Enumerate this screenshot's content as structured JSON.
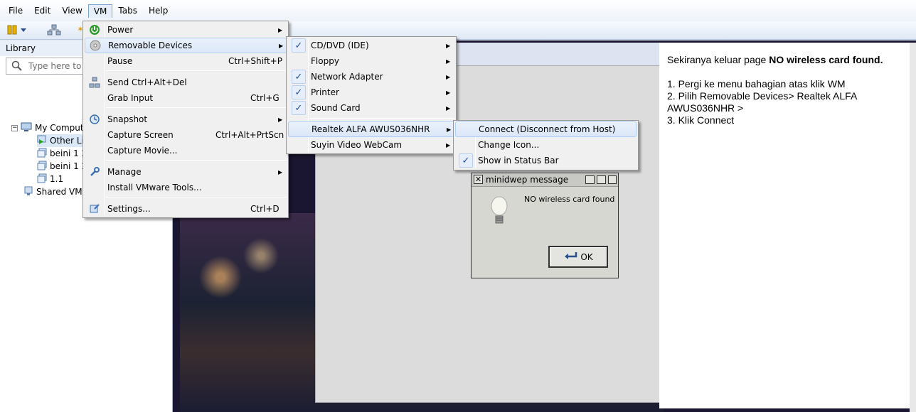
{
  "menubar": {
    "items": [
      "File",
      "Edit",
      "View",
      "VM",
      "Tabs",
      "Help"
    ],
    "active": "VM"
  },
  "library": {
    "title": "Library",
    "search_placeholder": "Type here to s",
    "tree": [
      {
        "label": "My Comput",
        "icon": "computer-icon"
      },
      {
        "label": "Other Li",
        "icon": "running-vm-icon"
      },
      {
        "label": "beini 1 2",
        "icon": "vm-icon"
      },
      {
        "label": "beini 1 2",
        "icon": "vm-icon"
      },
      {
        "label": "1.1",
        "icon": "vm-icon"
      },
      {
        "label": "Shared VMs",
        "icon": "shared-vms-icon"
      }
    ]
  },
  "vm_menu": {
    "items": [
      {
        "label": "Power",
        "shortcut": "",
        "submenu": true,
        "icon": "power-icon"
      },
      {
        "label": "Removable Devices",
        "shortcut": "",
        "submenu": true,
        "icon": "disc-icon"
      },
      {
        "label": "Pause",
        "shortcut": "Ctrl+Shift+P",
        "submenu": false
      },
      {
        "label": "Send Ctrl+Alt+Del",
        "shortcut": "",
        "submenu": false,
        "icon": "network-icon"
      },
      {
        "label": "Grab Input",
        "shortcut": "Ctrl+G",
        "submenu": false
      },
      {
        "label": "Snapshot",
        "shortcut": "",
        "submenu": true,
        "icon": "snapshot-icon"
      },
      {
        "label": "Capture Screen",
        "shortcut": "Ctrl+Alt+PrtScn",
        "submenu": false
      },
      {
        "label": "Capture Movie...",
        "shortcut": "",
        "submenu": false
      },
      {
        "label": "Manage",
        "shortcut": "",
        "submenu": true,
        "icon": "wrench-icon"
      },
      {
        "label": "Install VMware Tools...",
        "shortcut": "",
        "submenu": false
      },
      {
        "label": "Settings...",
        "shortcut": "Ctrl+D",
        "submenu": false,
        "icon": "settings-icon"
      }
    ]
  },
  "removable_menu": {
    "items": [
      {
        "label": "CD/DVD (IDE)",
        "checked": true
      },
      {
        "label": "Floppy",
        "checked": false
      },
      {
        "label": "Network Adapter",
        "checked": true
      },
      {
        "label": "Printer",
        "checked": true
      },
      {
        "label": "Sound Card",
        "checked": true
      },
      {
        "label": "Realtek ALFA  AWUS036NHR",
        "checked": false
      },
      {
        "label": "Suyin Video WebCam",
        "checked": false
      }
    ]
  },
  "device_menu": {
    "items": [
      {
        "label": "Connect (Disconnect from Host)",
        "checked": false
      },
      {
        "label": "Change Icon...",
        "checked": false
      },
      {
        "label": "Show in Status Bar",
        "checked": true
      }
    ]
  },
  "dialog": {
    "title": "minidwep message",
    "message": "NO wireless card found",
    "ok_label": "OK"
  },
  "panel": {
    "line1_prefix": "Sekiranya keluar page ",
    "line1_bold": "NO wireless card found.",
    "steps": [
      "1. Pergi ke menu bahagian atas klik WM",
      "2. Pilih Removable Devices> Realtek ALFA",
      "AWUS036NHR >",
      "3. Klik Connect"
    ]
  }
}
